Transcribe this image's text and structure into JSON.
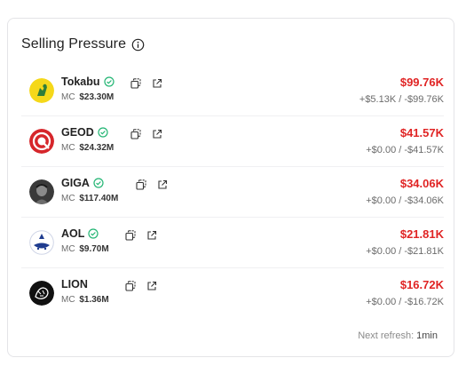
{
  "panel": {
    "title": "Selling Pressure"
  },
  "tokens": [
    {
      "name": "Tokabu",
      "mc_label": "MC",
      "mc_value": "$23.30M",
      "amount": "$99.76K",
      "delta": "+$5.13K / -$99.76K",
      "logo_color": "#f5d81a"
    },
    {
      "name": "GEOD",
      "mc_label": "MC",
      "mc_value": "$24.32M",
      "amount": "$41.57K",
      "delta": "+$0.00 / -$41.57K",
      "logo_color": "#d6262b"
    },
    {
      "name": "GIGA",
      "mc_label": "MC",
      "mc_value": "$117.40M",
      "amount": "$34.06K",
      "delta": "+$0.00 / -$34.06K",
      "logo_color": "#3a3a3a"
    },
    {
      "name": "AOL",
      "mc_label": "MC",
      "mc_value": "$9.70M",
      "amount": "$21.81K",
      "delta": "+$0.00 / -$21.81K",
      "logo_color": "#1f3c8f"
    },
    {
      "name": "LION",
      "mc_label": "MC",
      "mc_value": "$1.36M",
      "amount": "$16.72K",
      "delta": "+$0.00 / -$16.72K",
      "logo_color": "#111111"
    }
  ],
  "footer": {
    "label": "Next refresh:",
    "value": "1min"
  },
  "colors": {
    "negative": "#e02424",
    "verified": "#22b573"
  }
}
